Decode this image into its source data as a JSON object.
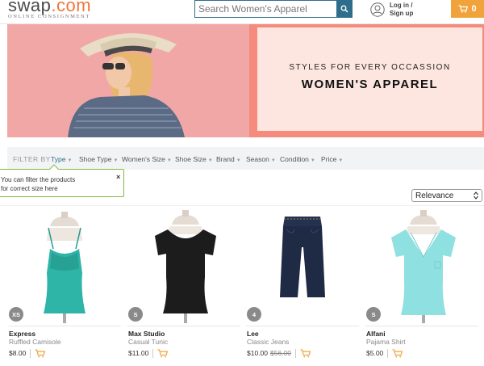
{
  "header": {
    "logo_text": "swap",
    "logo_dot": ".com",
    "logo_tagline": "ONLINE CONSIGNMENT",
    "search_placeholder": "Search Women's Apparel",
    "login_line1": "Log in /",
    "login_line2": "Sign up",
    "cart_count": "0",
    "accent_color": "#f0a33a",
    "search_color": "#2f6d8c"
  },
  "banner": {
    "kicker": "STYLES FOR EVERY OCCASSION",
    "title": "WOMEN'S APPAREL"
  },
  "filters": {
    "label": "FILTER BY",
    "items": [
      {
        "label": "Type",
        "active": true
      },
      {
        "label": "Shoe Type",
        "active": false
      },
      {
        "label": "Women's Size",
        "active": false
      },
      {
        "label": "Shoe Size",
        "active": false
      },
      {
        "label": "Brand",
        "active": false
      },
      {
        "label": "Season",
        "active": false
      },
      {
        "label": "Condition",
        "active": false
      },
      {
        "label": "Price",
        "active": false
      }
    ]
  },
  "tooltip": {
    "text_line1": "You can filter the products",
    "text_line2": "for correct size here",
    "close": "×"
  },
  "sort": {
    "selected": "Relevance"
  },
  "products": [
    {
      "size": "XS",
      "brand": "Express",
      "name": "Ruffled Camisole",
      "price": "$8.00",
      "original_price": "",
      "garment_color": "#2fb5a8",
      "icon": "camisole-icon"
    },
    {
      "size": "S",
      "brand": "Max Studio",
      "name": "Casual Tunic",
      "price": "$11.00",
      "original_price": "",
      "garment_color": "#1c1c1c",
      "icon": "tunic-icon"
    },
    {
      "size": "4",
      "brand": "Lee",
      "name": "Classic Jeans",
      "price": "$10.00",
      "original_price": "$56.00",
      "garment_color": "#1f2a44",
      "icon": "jeans-icon"
    },
    {
      "size": "S",
      "brand": "Alfani",
      "name": "Pajama Shirt",
      "price": "$5.00",
      "original_price": "",
      "garment_color": "#8fe0e0",
      "icon": "shirt-icon"
    }
  ]
}
